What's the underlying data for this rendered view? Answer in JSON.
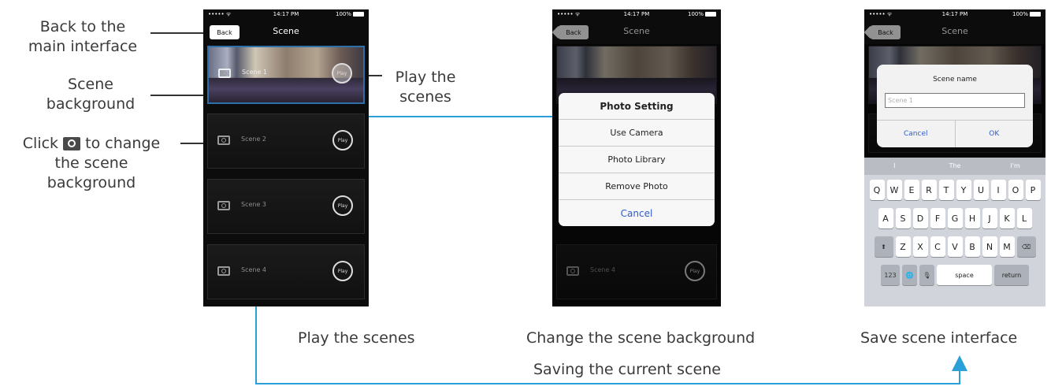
{
  "annotations": {
    "back_line1": "Back to the",
    "back_line2": "main interface",
    "scene_bg_line1": "Scene",
    "scene_bg_line2": "background",
    "click_prefix": "Click",
    "click_suffix": "to change",
    "click_line2": "the scene",
    "click_line3": "background",
    "play_line1": "Play the",
    "play_line2": "scenes"
  },
  "captions": {
    "phone1": "Play the scenes",
    "phone2": "Change the scene background",
    "phone3": "Save scene interface",
    "bottom": "Saving the current scene"
  },
  "statusbar": {
    "signal": "••••• ᯤ",
    "time": "14:17 PM",
    "battery": "100%"
  },
  "phone1": {
    "back_label": "Back",
    "title": "Scene",
    "scenes": [
      {
        "label": "Scene 1",
        "play": "Play"
      },
      {
        "label": "Scene 2",
        "play": "Play"
      },
      {
        "label": "Scene 3",
        "play": "Play"
      },
      {
        "label": "Scene 4",
        "play": "Play"
      }
    ]
  },
  "phone2": {
    "back_label": "Back",
    "title": "Scene",
    "sheet": {
      "title": "Photo Setting",
      "use_camera": "Use Camera",
      "photo_library": "Photo Library",
      "remove_photo": "Remove Photo",
      "cancel": "Cancel"
    },
    "scene4_label": "Scene 4",
    "play": "Play"
  },
  "phone3": {
    "back_label": "Back",
    "title": "Scene",
    "alert": {
      "title": "Scene name",
      "placeholder": "Scene 1",
      "cancel": "Cancel",
      "ok": "OK"
    },
    "suggestions": [
      "I",
      "The",
      "I'm"
    ],
    "row1": [
      "Q",
      "W",
      "E",
      "R",
      "T",
      "Y",
      "U",
      "I",
      "O",
      "P"
    ],
    "row2": [
      "A",
      "S",
      "D",
      "F",
      "G",
      "H",
      "J",
      "K",
      "L"
    ],
    "row3": [
      "Z",
      "X",
      "C",
      "V",
      "B",
      "N",
      "M"
    ],
    "shift": "⬆",
    "delete": "⌫",
    "numbers": "123",
    "globe": "🌐",
    "mic": "🎙",
    "space": "space",
    "return": "return"
  },
  "colors": {
    "arrow": "#2a9fd8",
    "line": "#333333"
  }
}
